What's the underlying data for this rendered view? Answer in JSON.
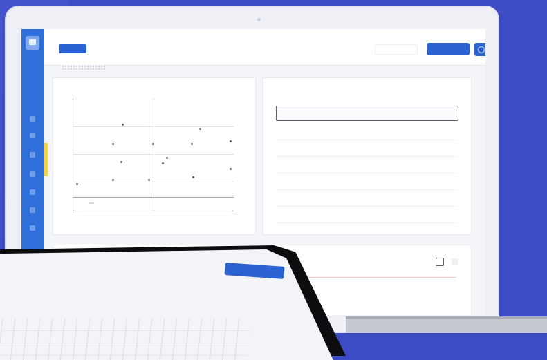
{
  "colors": {
    "background": "#3d4cc4",
    "accent": "#2c63d2",
    "sidebar": "#2f6fd9",
    "highlight": "#f2d34a"
  },
  "header": {
    "brand_label": "",
    "search_placeholder": "",
    "primary_button_label": "",
    "settings_icon": "settings-icon"
  },
  "sidebar": {
    "logo_icon": "app-logo-icon",
    "icons": [
      "nav-icon-1",
      "nav-icon-2",
      "nav-icon-3",
      "nav-icon-4",
      "nav-icon-5",
      "nav-icon-6",
      "nav-icon-7"
    ]
  },
  "scatter_panel": {
    "title": "",
    "legend_label": ""
  },
  "table_panel": {
    "title": "",
    "subtitle": "",
    "filter_label": "",
    "columns": [
      "",
      "",
      "",
      "",
      ""
    ],
    "rows": [
      [
        "",
        "",
        "",
        "",
        ""
      ],
      [
        "",
        "",
        "",
        "",
        ""
      ],
      [
        "",
        "",
        "",
        "",
        ""
      ],
      [
        "",
        "",
        "",
        "",
        ""
      ],
      [
        "",
        "",
        "",
        "",
        ""
      ],
      [
        "",
        "",
        "",
        "",
        ""
      ],
      [
        "",
        "",
        "",
        "",
        ""
      ]
    ]
  },
  "bottom_panel": {
    "add_icon": "plus-icon",
    "more_icon": "more-icon"
  },
  "tablet": {
    "button_label": "",
    "filter_label": "",
    "sort_label": ""
  }
}
